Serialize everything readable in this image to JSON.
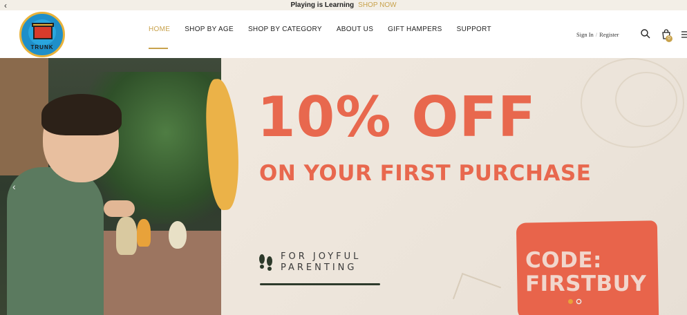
{
  "announcement": {
    "message": "Playing is Learning",
    "cta": "SHOP NOW",
    "prev_arrow": "‹"
  },
  "logo": {
    "text": "TRUNK",
    "icon": "toy-trunk-logo"
  },
  "nav": {
    "items": [
      {
        "label": "HOME",
        "active": true
      },
      {
        "label": "SHOP BY AGE",
        "active": false
      },
      {
        "label": "SHOP BY CATEGORY",
        "active": false
      },
      {
        "label": "ABOUT US",
        "active": false
      },
      {
        "label": "GIFT HAMPERS",
        "active": false
      },
      {
        "label": "SUPPORT",
        "active": false
      }
    ]
  },
  "account": {
    "sign_in": "Sign In",
    "separator": "/",
    "register": "Register"
  },
  "cart": {
    "count": "0"
  },
  "hero": {
    "headline": "10% OFF",
    "subline": "ON YOUR FIRST PURCHASE",
    "tagline_line1": "FOR JOYFUL",
    "tagline_line2": "PARENTING",
    "code_label": "CODE:",
    "code_value": "FIRSTBUY",
    "prev_arrow": "‹",
    "slides": 2,
    "active_slide": 1
  },
  "colors": {
    "accent": "#c8a24c",
    "promo": "#e8684e",
    "banner_bg": "#ece4da"
  }
}
